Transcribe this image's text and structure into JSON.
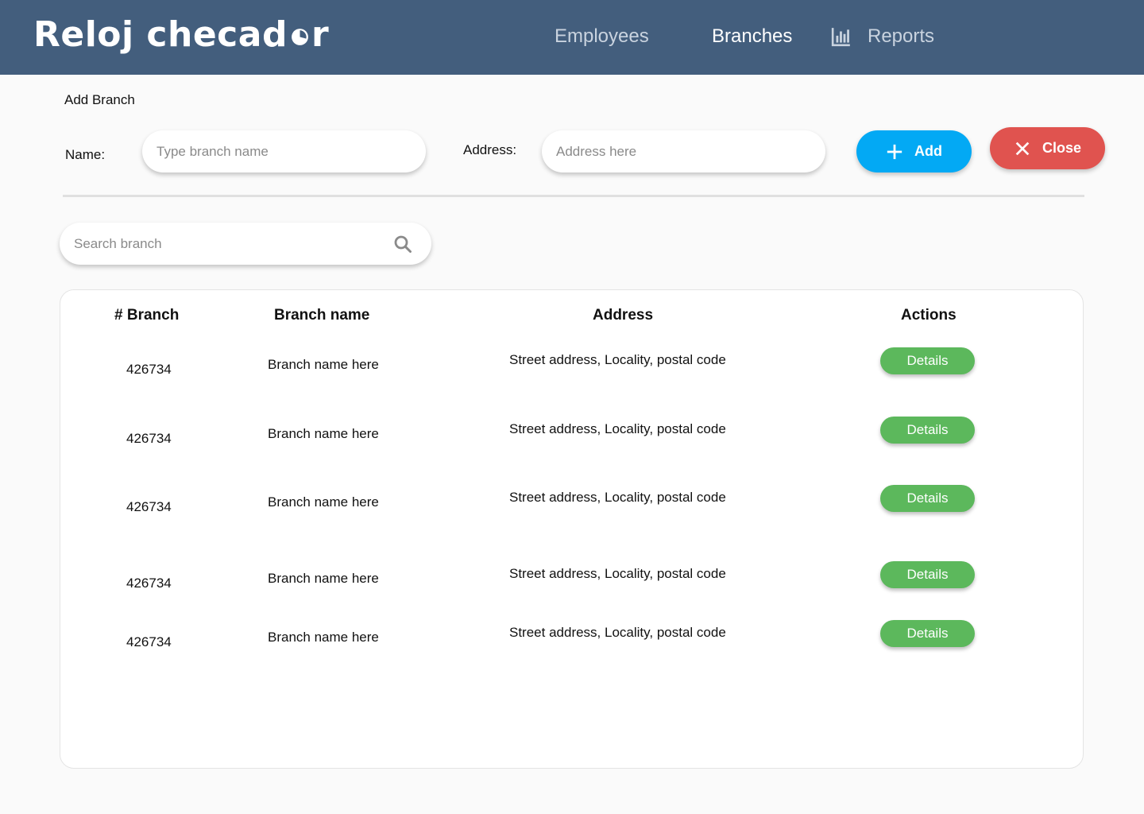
{
  "header": {
    "logo_text": "Reloj checad",
    "logo_tail": "r",
    "nav": {
      "employees": "Employees",
      "branches": "Branches",
      "reports": "Reports"
    }
  },
  "add_branch": {
    "title": "Add Branch",
    "name_label": "Name:",
    "name_placeholder": "Type branch name",
    "address_label": "Address:",
    "address_placeholder": "Address here",
    "add_label": "Add",
    "close_label": "Close"
  },
  "search": {
    "placeholder": "Search branch"
  },
  "table": {
    "headers": {
      "number": "# Branch",
      "name": "Branch name",
      "address": "Address",
      "actions": "Actions"
    },
    "rows": [
      {
        "number": "426734",
        "name": "Branch name here",
        "address": "Street address, Locality, postal code",
        "action": "Details"
      },
      {
        "number": "426734",
        "name": "Branch name here",
        "address": "Street address, Locality, postal code",
        "action": "Details"
      },
      {
        "number": "426734",
        "name": "Branch name here",
        "address": "Street address, Locality, postal code",
        "action": "Details"
      },
      {
        "number": "426734",
        "name": "Branch name here",
        "address": "Street address, Locality, postal code",
        "action": "Details"
      },
      {
        "number": "426734",
        "name": "Branch name here",
        "address": "Street address, Locality, postal code",
        "action": "Details"
      }
    ]
  },
  "colors": {
    "header_bg": "#435e7d",
    "add_button": "#03a9f4",
    "close_button": "#e0534f",
    "details_button": "#5cb85c"
  }
}
